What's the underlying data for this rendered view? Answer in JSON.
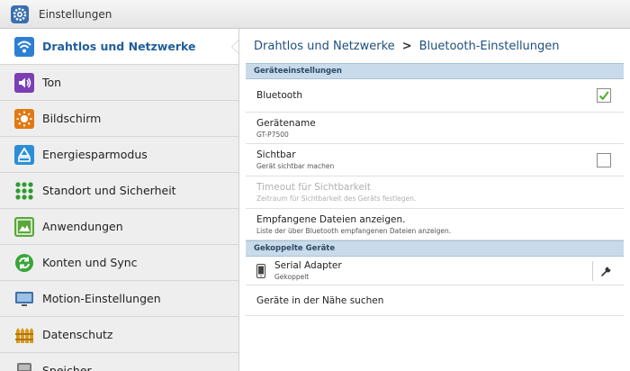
{
  "app": {
    "title": "Einstellungen"
  },
  "sidebar": {
    "items": [
      {
        "label": "Drahtlos und Netzwerke",
        "icon": "wifi-icon",
        "active": true
      },
      {
        "label": "Ton",
        "icon": "speaker-icon"
      },
      {
        "label": "Bildschirm",
        "icon": "brightness-icon"
      },
      {
        "label": "Energiesparmodus",
        "icon": "recycle-icon"
      },
      {
        "label": "Standort und Sicherheit",
        "icon": "grid-icon"
      },
      {
        "label": "Anwendungen",
        "icon": "apps-icon"
      },
      {
        "label": "Konten und Sync",
        "icon": "sync-icon"
      },
      {
        "label": "Motion-Einstellungen",
        "icon": "monitor-icon"
      },
      {
        "label": "Datenschutz",
        "icon": "fence-icon"
      },
      {
        "label": "Speicher",
        "icon": "storage-icon"
      }
    ]
  },
  "breadcrumb": {
    "parent": "Drahtlos und Netzwerke",
    "separator": ">",
    "current": "Bluetooth-Einstellungen"
  },
  "sections": {
    "device_settings": {
      "title": "Geräteeinstellungen"
    },
    "paired": {
      "title": "Gekoppelte Geräte"
    }
  },
  "settings": {
    "bluetooth": {
      "title": "Bluetooth",
      "checked": true
    },
    "device_name": {
      "title": "Gerätename",
      "value": "GT-P7500"
    },
    "visible": {
      "title": "Sichtbar",
      "summary": "Gerät sichtbar machen",
      "checked": false
    },
    "timeout": {
      "title": "Timeout für Sichtbarkeit",
      "summary": "Zeitraum für Sichtbarkeit des Geräts festlegen."
    },
    "received": {
      "title": "Empfangene Dateien anzeigen.",
      "summary": "Liste der über Bluetooth empfangenen Dateien anzeigen."
    }
  },
  "paired_devices": [
    {
      "name": "Serial Adapter",
      "status": "Gekoppelt",
      "icon": "phone-icon"
    }
  ],
  "scan": {
    "label": "Geräte in der Nähe suchen"
  },
  "colors": {
    "accent": "#1f5e9a",
    "section_bg": "#c9dbea",
    "check": "#4caf1f"
  }
}
